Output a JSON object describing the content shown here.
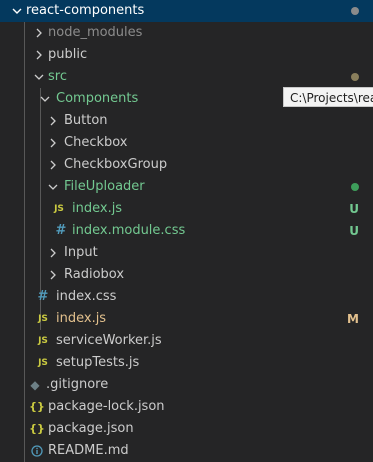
{
  "explorer": {
    "root": {
      "label": "react-components",
      "status_color": "#8b8b8b"
    },
    "items": [
      {
        "label": "node_modules",
        "type": "folder-collapsed",
        "color": "#8c8c8c"
      },
      {
        "label": "public",
        "type": "folder-collapsed",
        "color": "#cccccc"
      },
      {
        "label": "src",
        "type": "folder-expanded",
        "color": "#73c991",
        "status_color": "#8a7f5c"
      },
      {
        "label": "Components",
        "type": "folder-expanded",
        "color": "#73c991"
      },
      {
        "label": "Button",
        "type": "folder-collapsed",
        "color": "#cccccc"
      },
      {
        "label": "Checkbox",
        "type": "folder-collapsed",
        "color": "#cccccc"
      },
      {
        "label": "CheckboxGroup",
        "type": "folder-collapsed",
        "color": "#cccccc"
      },
      {
        "label": "FileUploader",
        "type": "folder-expanded",
        "color": "#73c991",
        "status_color": "#3e9e5b"
      },
      {
        "label": "index.js",
        "type": "file-js",
        "icon_text": "JS",
        "color": "#73c991",
        "badge": "U"
      },
      {
        "label": "index.module.css",
        "type": "file-css",
        "icon_text": "#",
        "color": "#73c991",
        "badge": "U"
      },
      {
        "label": "Input",
        "type": "folder-collapsed",
        "color": "#cccccc"
      },
      {
        "label": "Radiobox",
        "type": "folder-collapsed",
        "color": "#cccccc"
      },
      {
        "label": "index.css",
        "type": "file-css",
        "icon_text": "#",
        "color": "#cccccc"
      },
      {
        "label": "index.js",
        "type": "file-js",
        "icon_text": "JS",
        "color": "#e2c08d",
        "badge": "M"
      },
      {
        "label": "serviceWorker.js",
        "type": "file-js",
        "icon_text": "JS",
        "color": "#cccccc"
      },
      {
        "label": "setupTests.js",
        "type": "file-js",
        "icon_text": "JS",
        "color": "#cccccc"
      },
      {
        "label": ".gitignore",
        "type": "file-git",
        "icon_text": "◆",
        "color": "#cccccc"
      },
      {
        "label": "package-lock.json",
        "type": "file-json",
        "icon_text": "{}",
        "color": "#cccccc"
      },
      {
        "label": "package.json",
        "type": "file-json",
        "icon_text": "{}",
        "color": "#cccccc"
      },
      {
        "label": "README.md",
        "type": "file-info",
        "icon_text": "ⓘ",
        "color": "#cccccc"
      }
    ]
  },
  "tooltip": {
    "text": "C:\\Projects\\react-components\\src"
  },
  "colors": {
    "badge_untracked": "#73c991",
    "badge_modified": "#e2c08d",
    "icon_js": "#cbcb41",
    "icon_css": "#519aba"
  }
}
